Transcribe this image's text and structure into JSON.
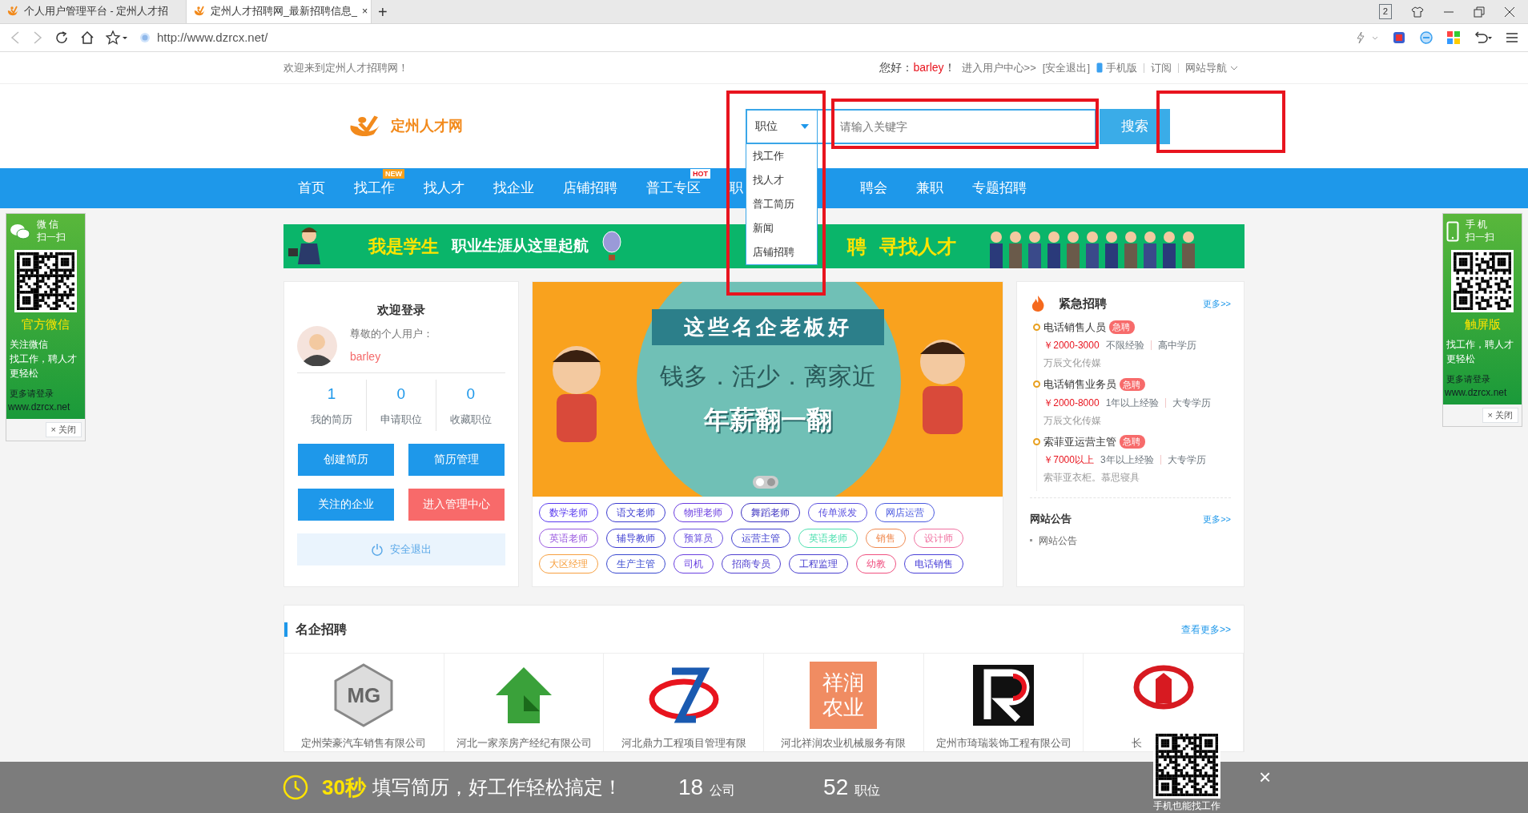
{
  "browser": {
    "tabs": [
      {
        "title": "个人用户管理平台 - 定州人才招",
        "selected": false
      },
      {
        "title": "定州人才招聘网_最新招聘信息_",
        "selected": true
      }
    ],
    "close_tab": "×",
    "new_tab": "+",
    "tab_count": "2",
    "url": "http://www.dzrcx.net/"
  },
  "top_bar": {
    "welcome": "欢迎来到定州人才招聘网！",
    "greeting": "您好：",
    "username": "barley",
    "exclaim": "！",
    "user_center": "进入用户中心>>",
    "logout": "[安全退出]",
    "mobile": "手机版",
    "subscribe": "订阅",
    "site_nav": "网站导航"
  },
  "header": {
    "logo_text": "定州人才网",
    "search": {
      "category": "职位",
      "dropdown_open": true,
      "options": [
        "找工作",
        "找人才",
        "普工简历",
        "新闻",
        "店铺招聘"
      ],
      "placeholder": "请输入关键字",
      "button": "搜索",
      "highlights": {
        "category": true,
        "keyword": true,
        "button": true
      }
    }
  },
  "nav": [
    {
      "label": "首页"
    },
    {
      "label": "找工作",
      "badge": "NEW"
    },
    {
      "label": "找人才"
    },
    {
      "label": "找企业"
    },
    {
      "label": "店铺招聘"
    },
    {
      "label": "普工专区",
      "badge": "HOT"
    },
    {
      "label": "职"
    },
    {
      "label": "聘会"
    },
    {
      "label": "兼职"
    },
    {
      "label": "专题招聘"
    }
  ],
  "banner": {
    "headline": "我是学生",
    "tagline": "职业生涯从这里起航",
    "partial": "聘",
    "right_headline": "寻找人才"
  },
  "login": {
    "title": "欢迎登录",
    "salutation": "尊敬的个人用户：",
    "username": "barley",
    "stats": [
      {
        "value": "1",
        "label": "我的简历"
      },
      {
        "value": "0",
        "label": "申请职位"
      },
      {
        "value": "0",
        "label": "收藏职位"
      }
    ],
    "buttons": [
      {
        "label": "创建简历",
        "kind": "primary"
      },
      {
        "label": "简历管理",
        "kind": "primary"
      },
      {
        "label": "关注的企业",
        "kind": "primary"
      },
      {
        "label": "进入管理中心",
        "kind": "danger"
      }
    ],
    "logout": "安全退出"
  },
  "slide": {
    "title": "这些名企老板好",
    "line": "钱多．活少．离家近",
    "slogan": "年薪翻一翻",
    "dots": [
      {
        "selected": true
      },
      {
        "selected": false
      }
    ]
  },
  "tags": [
    {
      "label": "数学老师",
      "color": "#5a3cf0"
    },
    {
      "label": "语文老师",
      "color": "#3c3cd0"
    },
    {
      "label": "物理老师",
      "color": "#6a3ce0"
    },
    {
      "label": "舞蹈老师",
      "color": "#3a30c0"
    },
    {
      "label": "传单派发",
      "color": "#5a50e0"
    },
    {
      "label": "网店运营",
      "color": "#4a5ae0"
    },
    {
      "label": "英语老师",
      "color": "#9a5ae0"
    },
    {
      "label": "辅导教师",
      "color": "#3a3ad0"
    },
    {
      "label": "预算员",
      "color": "#6a50e0"
    },
    {
      "label": "运营主管",
      "color": "#4040d0"
    },
    {
      "label": "英语老师",
      "color": "#4ee0b0"
    },
    {
      "label": "销售",
      "color": "#f08a50"
    },
    {
      "label": "设计师",
      "color": "#f070a0"
    },
    {
      "label": "大区经理",
      "color": "#f7a040"
    },
    {
      "label": "生产主管",
      "color": "#3a4ad0"
    },
    {
      "label": "司机",
      "color": "#6a40e0"
    },
    {
      "label": "招商专员",
      "color": "#5040d0"
    },
    {
      "label": "工程监理",
      "color": "#4a40d0"
    },
    {
      "label": "幼教",
      "color": "#f05080"
    },
    {
      "label": "电话销售",
      "color": "#4a40d8"
    }
  ],
  "urgent": {
    "title": "紧急招聘",
    "more": "更多>>",
    "jobs": [
      {
        "title": "电话销售人员",
        "badge": "急聘",
        "salary": "￥2000-3000",
        "experience": "不限经验",
        "education": "高中学历",
        "company": "万辰文化传媒"
      },
      {
        "title": "电话销售业务员",
        "badge": "急聘",
        "salary": "￥2000-8000",
        "experience": "1年以上经验",
        "education": "大专学历",
        "company": "万辰文化传媒"
      },
      {
        "title": "索菲亚运营主管",
        "badge": "急聘",
        "salary": "￥7000以上",
        "experience": "3年以上经验",
        "education": "大专学历",
        "company": "索菲亚衣柜。慕思寝具"
      }
    ]
  },
  "notice": {
    "title": "网站公告",
    "more": "更多>>",
    "items": [
      "网站公告"
    ]
  },
  "companies": {
    "title": "名企招聘",
    "more": "查看更多>>",
    "items": [
      {
        "name": "定州荣豪汽车销售有限公司",
        "kind": "mg",
        "logo_text": "MG"
      },
      {
        "name": "河北一家亲房产经纪有限公司",
        "kind": "house"
      },
      {
        "name": "河北鼎力工程项目管理有限",
        "kind": "swoosh"
      },
      {
        "name": "河北祥润农业机械服务有限",
        "kind": "text",
        "logo_text": "祥润农业"
      },
      {
        "name": "定州市琦瑞装饰工程有限公司",
        "kind": "r"
      },
      {
        "name": "长",
        "kind": "emblem"
      }
    ]
  },
  "left_float": {
    "title_top": "微 信",
    "title_bottom": "扫一扫",
    "caption": "官方微信",
    "lines": [
      "关注微信",
      "找工作，聘人才更轻松"
    ],
    "login_hint": "更多请登录",
    "site": "www.dzrcx.net",
    "close": "× 关闭"
  },
  "right_float": {
    "title_top": "手 机",
    "title_bottom": "扫一扫",
    "caption": "触屏版",
    "lines": [
      "找工作，聘人才更轻松"
    ],
    "login_hint": "更多请登录",
    "site": "www.dzrcx.net",
    "close": "× 关闭"
  },
  "bottom_bar": {
    "time": "30秒",
    "message": "填写简历，好工作轻松搞定！",
    "companies_count": "18",
    "companies_unit": "公司",
    "jobs_count": "52",
    "jobs_unit": "职位",
    "qr_caption": "手机也能找工作",
    "close": "×"
  }
}
